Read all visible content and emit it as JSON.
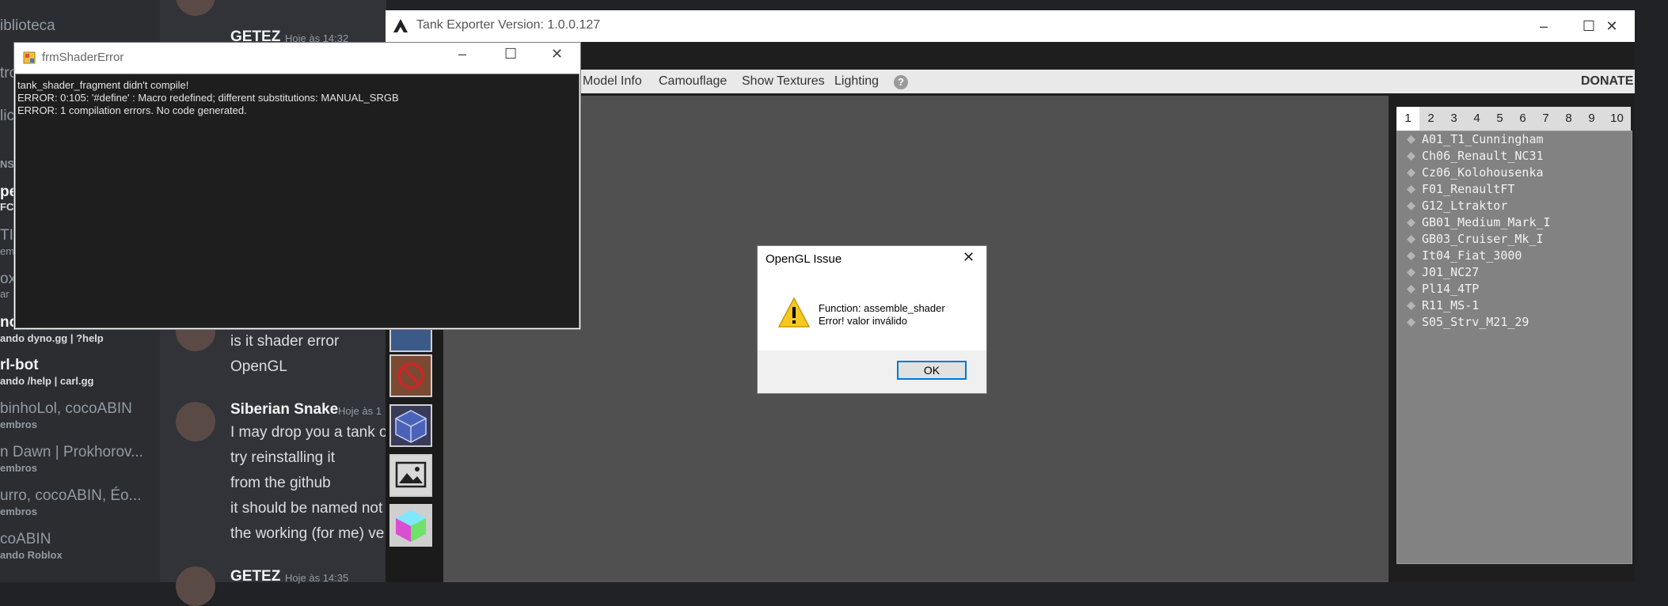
{
  "discord": {
    "sidebar": {
      "biblioteca": "iblioteca",
      "frag1": "tro",
      "frag2": "lic",
      "section_label": "NSI",
      "frag3": "pe",
      "frag3b": "FC",
      "frag4": "TI",
      "frag4b": "em",
      "frag5": "ox",
      "frag5b": "ar",
      "frag6": "no",
      "frag6b": "ando dyno.gg | ?help",
      "carl_name": "rl-bot",
      "carl_status": "ando /help | carl.gg",
      "group1_name": "binhoLol, cocoABIN",
      "group1_sub": "embros",
      "group2_name": "n Dawn | Prokhorov...",
      "group2_sub": "embros",
      "group3_name": "urro, cocoABIN, Éo...",
      "group3_sub": "embros",
      "coco_name": "coABIN",
      "coco_status": "ando Roblox"
    },
    "chat": {
      "msg1_author": "GETEZ",
      "msg1_time": "Hoje às 14:32",
      "line_a": "is it shader error",
      "line_b": "OpenGL",
      "msg2_author": "Siberian Snake",
      "msg2_time": "Hoje às 1",
      "msg2_lines": [
        "I may drop you a tank o",
        "try reinstalling it",
        "from the github",
        "it should be named not",
        "the working (for me) ve"
      ],
      "msg3_author": "GETEZ",
      "msg3_time": "Hoje às 14:35"
    }
  },
  "tank_exporter": {
    "title": "Tank Exporter Version: 1.0.0.127",
    "toolbar": {
      "model_info": "Model Info",
      "camouflage": "Camouflage",
      "show_textures": "Show Textures",
      "lighting": "Lighting",
      "help": "?",
      "donate": "DONATE"
    },
    "tabs": [
      "1",
      "2",
      "3",
      "4",
      "5",
      "6",
      "7",
      "8",
      "9",
      "10"
    ],
    "tanks": [
      "A01_T1_Cunningham",
      "Ch06_Renault_NC31",
      "Cz06_Kolohousenka",
      "F01_RenaultFT",
      "G12_Ltraktor",
      "GB01_Medium_Mark_I",
      "GB03_Cruiser_Mk_I",
      "It04_Fiat_3000",
      "J01_NC27",
      "Pl14_4TP",
      "R11_MS-1",
      "S05_Strv_M21_29"
    ]
  },
  "shader_error": {
    "title": "frmShaderError",
    "lines": [
      "tank_shader_fragment didn't compile!",
      "ERROR: 0:105: '#define' : Macro redefined; different substitutions: MANUAL_SRGB",
      "ERROR: 1 compilation errors.  No code generated."
    ]
  },
  "dialog": {
    "title": "OpenGL Issue",
    "line1": "Function: assemble_shader",
    "line2": "Error! valor inválido",
    "ok": "OK"
  },
  "colors": {
    "discord_bg": "#313338",
    "viewport": "#505050",
    "list_bg": "#828282",
    "dialog_ok_border": "#0078d7"
  }
}
